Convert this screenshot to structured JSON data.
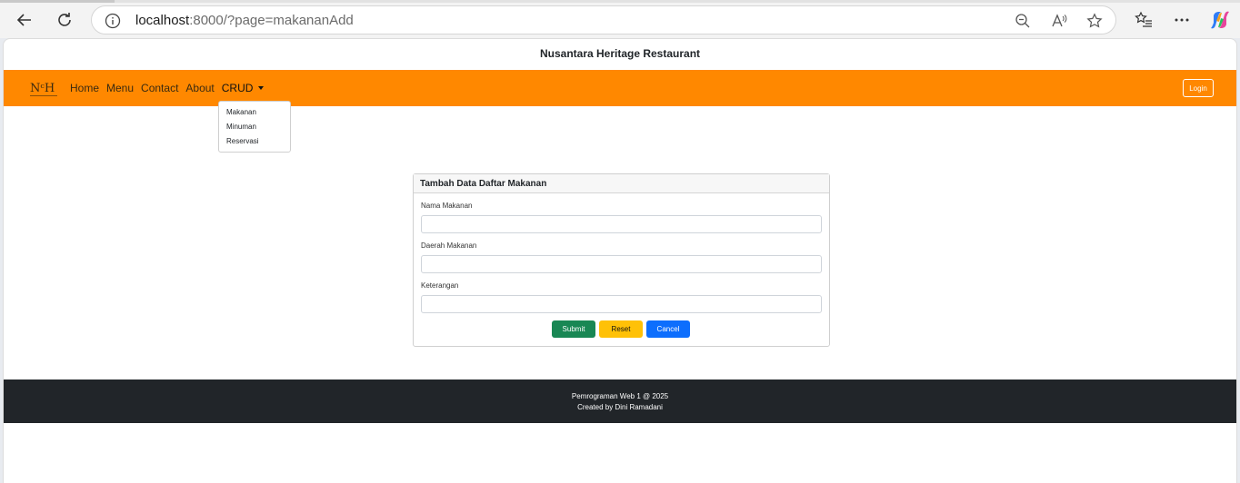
{
  "browser": {
    "url_host": "localhost",
    "url_rest": ":8000/?page=makananAdd"
  },
  "site": {
    "title": "Nusantara Heritage Restaurant",
    "logo_text": "NᶜH"
  },
  "navbar": {
    "links": [
      "Home",
      "Menu",
      "Contact",
      "About"
    ],
    "crud_label": "CRUD",
    "login_label": "Login",
    "bg_color": "#ff8800"
  },
  "dropdown": {
    "items": [
      "Makanan",
      "Minuman",
      "Reservasi"
    ]
  },
  "form": {
    "header": "Tambah Data Daftar Makanan",
    "fields": [
      {
        "label": "Nama Makanan",
        "value": ""
      },
      {
        "label": "Daerah Makanan",
        "value": ""
      },
      {
        "label": "Keterangan",
        "value": ""
      }
    ],
    "submit_label": "Submit",
    "reset_label": "Reset",
    "cancel_label": "Cancel"
  },
  "footer": {
    "line1": "Pemrograman Web 1 @ 2025",
    "line2": "Created by Dini Ramadani"
  }
}
